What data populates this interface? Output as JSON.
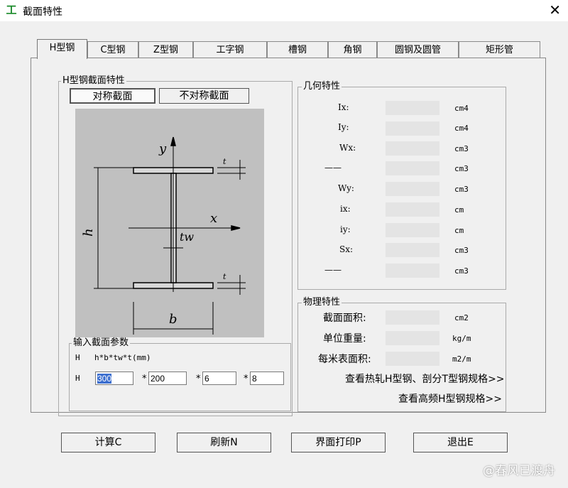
{
  "window": {
    "title": "截面特性",
    "icon_glyph": "工",
    "close_glyph": "✕"
  },
  "tabs": [
    {
      "label": "H型钢",
      "active": true
    },
    {
      "label": "C型钢"
    },
    {
      "label": "Z型钢"
    },
    {
      "label": "工字钢"
    },
    {
      "label": "槽钢"
    },
    {
      "label": "角钢"
    },
    {
      "label": "圆钢及圆管"
    },
    {
      "label": "矩形管"
    }
  ],
  "section": {
    "group_label": "H型钢截面特性",
    "symmetric_label": "对称截面",
    "asymmetric_label": "不对称截面",
    "diagram_labels": {
      "y": "y",
      "x": "x",
      "tw": "tw",
      "h": "h",
      "b": "b",
      "t_top": "t",
      "t_bottom": "t"
    }
  },
  "inputs": {
    "group_label": "输入截面参数",
    "formula_prefix": "H",
    "formula": "h*b*tw*t(mm)",
    "row_prefix": "H",
    "star": "*",
    "h": "300",
    "b": "200",
    "tw": "6",
    "t": "8"
  },
  "geometry": {
    "group_label": "几何特性",
    "rows": [
      {
        "label": "Ix:",
        "unit": "cm4"
      },
      {
        "label": "Iy:",
        "unit": "cm4"
      },
      {
        "label": "Wx:",
        "unit": "cm3"
      },
      {
        "label": "——",
        "unit": "cm3"
      },
      {
        "label": "Wy:",
        "unit": "cm3"
      },
      {
        "label": "ix:",
        "unit": "cm"
      },
      {
        "label": "iy:",
        "unit": "cm"
      },
      {
        "label": "Sx:",
        "unit": "cm3"
      },
      {
        "label": "——",
        "unit": "cm3"
      }
    ]
  },
  "physical": {
    "group_label": "物理特性",
    "rows": [
      {
        "label": "截面面积:",
        "unit": "cm2"
      },
      {
        "label": "单位重量:",
        "unit": "kg/m"
      },
      {
        "label": "每米表面积:",
        "unit": "m2/m"
      }
    ],
    "link_hot_rolled": "查看热轧H型钢、剖分T型钢规格>>",
    "link_high_freq": "查看高频H型钢规格>>"
  },
  "buttons": {
    "calculate": "计算C",
    "refresh": "刷新N",
    "print": "界面打印P",
    "exit": "退出E"
  },
  "watermark": "@春风已渡舟"
}
